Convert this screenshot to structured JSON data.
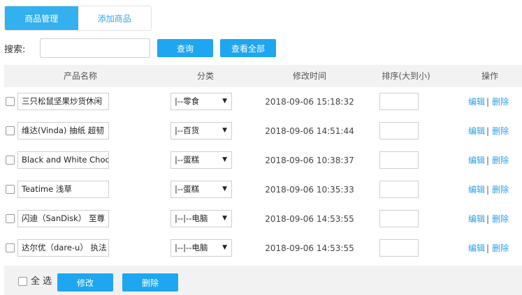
{
  "tabs": [
    {
      "label": "商品管理",
      "active": true
    },
    {
      "label": "添加商品",
      "active": false
    }
  ],
  "search": {
    "label": "搜索:",
    "value": "",
    "placeholder": "",
    "query_button": "查询",
    "all_button": "查看全部"
  },
  "table": {
    "headers": {
      "name": "产品名称",
      "category": "分类",
      "time": "修改时间",
      "sort": "排序(大到小)",
      "ops": "操作"
    },
    "rows": [
      {
        "name": "三只松鼠坚果炒货休闲",
        "category": "|--零食",
        "time": "2018-09-06 15:18:32",
        "sort": "",
        "edit": "编辑",
        "sep": "|",
        "delete": "删除"
      },
      {
        "name": "维达(Vinda) 抽纸 超韧",
        "category": "|--百货",
        "time": "2018-09-06 14:51:44",
        "sort": "",
        "edit": "编辑",
        "sep": "|",
        "delete": "删除"
      },
      {
        "name": "Black and White Choc",
        "category": "|--蛋糕",
        "time": "2018-09-06 10:38:37",
        "sort": "",
        "edit": "编辑",
        "sep": "|",
        "delete": "删除"
      },
      {
        "name": "Teatime 浅草",
        "category": "|--蛋糕",
        "time": "2018-09-06 10:35:33",
        "sort": "",
        "edit": "编辑",
        "sep": "|",
        "delete": "删除"
      },
      {
        "name": "闪迪（SanDisk） 至尊",
        "category": "|--|--电脑",
        "time": "2018-09-06 14:53:55",
        "sort": "",
        "edit": "编辑",
        "sep": "|",
        "delete": "删除"
      },
      {
        "name": "达尔优（dare-u） 执法",
        "category": "|--|--电脑",
        "time": "2018-09-06 14:53:55",
        "sort": "",
        "edit": "编辑",
        "sep": "|",
        "delete": "删除"
      }
    ]
  },
  "footer": {
    "select_all": "全 选",
    "edit_button": "修改",
    "delete_button": "删除"
  },
  "icons": {
    "dropdown": "chevron-down-icon"
  },
  "colors": {
    "accent": "#1ea6f0",
    "tab_active": "#33b0ee",
    "link": "#2e9fe3",
    "header_bg": "#f2f2f2"
  }
}
